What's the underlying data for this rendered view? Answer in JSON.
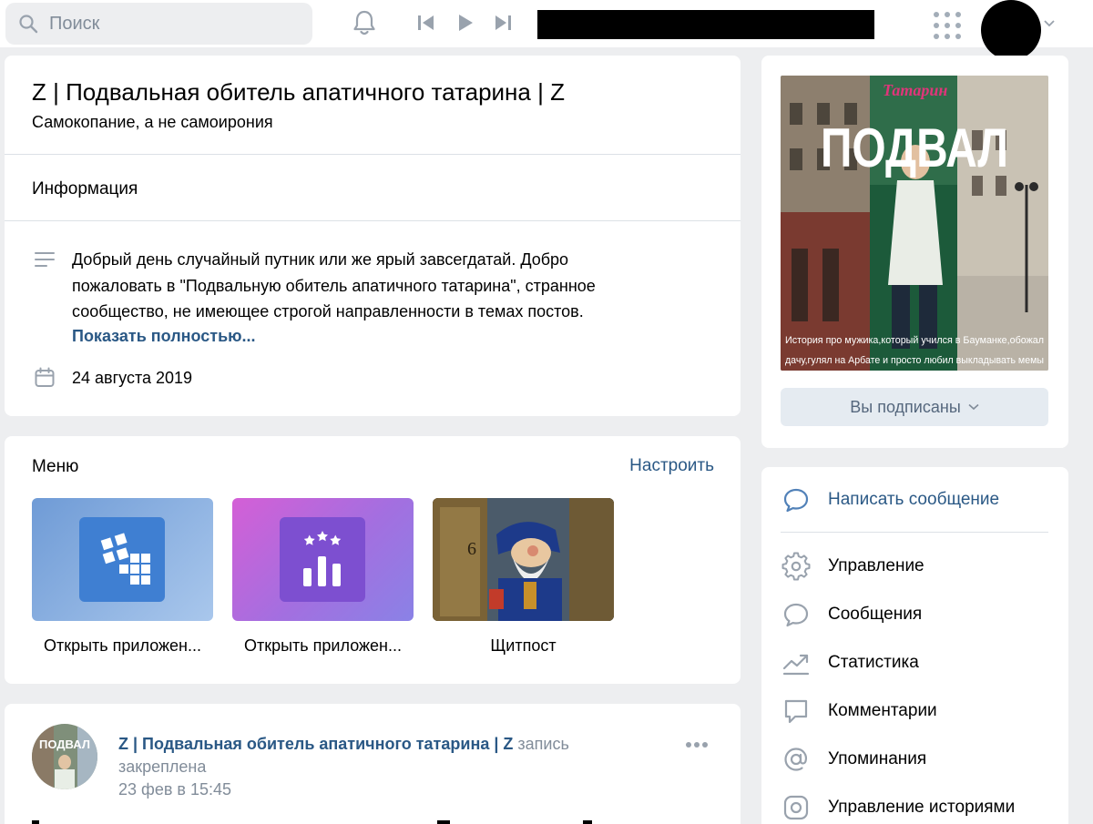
{
  "header": {
    "search_placeholder": "Поиск"
  },
  "group": {
    "title": "Z | Подвальная обитель апатичного татарина | Z",
    "status": "Самокопание, а не самоирония",
    "info_heading": "Информация",
    "description": "Добрый день случайный путник или же ярый завсегдатай. Добро пожаловать в \"Подвальную обитель апатичного татарина\", странное сообщество, не имеющее строгой направленности в темах постов.",
    "show_more": "Показать полностью...",
    "created_date": "24 августа 2019"
  },
  "menu": {
    "title": "Меню",
    "configure": "Настроить",
    "items": [
      {
        "label": "Открыть приложен..."
      },
      {
        "label": "Открыть приложен..."
      },
      {
        "label": "Щитпост"
      }
    ]
  },
  "post": {
    "author": "Z | Подвальная обитель апатичного татарина | Z",
    "pinned_note": " запись закреплена",
    "time": "23 фев в 15:45",
    "avatar_text": "ПОДВАЛ"
  },
  "cover": {
    "brand": "Татарин",
    "headline": "ПОДВАЛ",
    "caption_line1": "История про мужика,который учился в Бауманке,обожал",
    "caption_line2": "дачу,гулял на Арбате и просто любил выкладывать мемы",
    "subscribed_label": "Вы подписаны"
  },
  "actions": {
    "items": [
      {
        "label": "Написать сообщение",
        "icon": "message-icon"
      },
      {
        "label": "Управление",
        "icon": "gear-icon"
      },
      {
        "label": "Сообщения",
        "icon": "chat-icon"
      },
      {
        "label": "Статистика",
        "icon": "stats-icon"
      },
      {
        "label": "Комментарии",
        "icon": "comment-icon"
      },
      {
        "label": "Упоминания",
        "icon": "at-icon"
      },
      {
        "label": "Управление историями",
        "icon": "stories-icon"
      }
    ]
  },
  "colors": {
    "link": "#2a5885",
    "accent_icon": "#5181b8",
    "muted": "#818c99",
    "background": "#edeef0"
  }
}
